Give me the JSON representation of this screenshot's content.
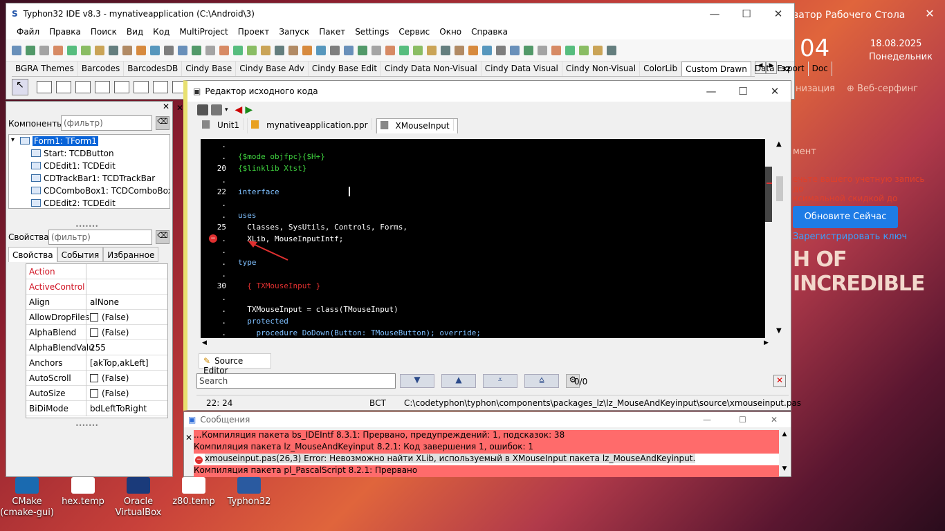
{
  "main": {
    "title": "Typhon32 IDE v8.3 - mynativeapplication (C:\\Android\\3)",
    "menu": [
      "Файл",
      "Правка",
      "Поиск",
      "Вид",
      "Код",
      "MultiProject",
      "Проект",
      "Запуск",
      "Пакет",
      "Settings",
      "Сервис",
      "Окно",
      "Справка"
    ],
    "palette_tabs": [
      "BGRA Themes",
      "Barcodes",
      "BarcodesDB",
      "Cindy Base",
      "Cindy Base Adv",
      "Cindy Base Edit",
      "Cindy Data Non-Visual",
      "Cindy Data Visual",
      "Cindy Non-Visual",
      "ColorLib",
      "Custom Drawn",
      "Data Export",
      "Doc"
    ],
    "bitness": "32"
  },
  "inspector": {
    "components_label": "Компоненты",
    "filter_placeholder": "(фильтр)",
    "tree": [
      "Form1: TForm1",
      "Start: TCDButton",
      "CDEdit1: TCDEdit",
      "CDTrackBar1: TCDTrackBar",
      "CDComboBox1: TCDComboBox",
      "CDEdit2: TCDEdit"
    ],
    "props_label": "Свойства",
    "props_filter_placeholder": "(фильтр)",
    "tabs": [
      "Свойства",
      "События",
      "Избранное"
    ],
    "rows": [
      {
        "name": "Action",
        "value": ""
      },
      {
        "name": "ActiveControl",
        "value": ""
      },
      {
        "name": "Align",
        "value": "alNone"
      },
      {
        "name": "AllowDropFiles",
        "value": "(False)"
      },
      {
        "name": "AlphaBlend",
        "value": "(False)"
      },
      {
        "name": "AlphaBlendValu",
        "value": "255"
      },
      {
        "name": "Anchors",
        "value": "[akTop,akLeft]"
      },
      {
        "name": "AutoScroll",
        "value": "(False)"
      },
      {
        "name": "AutoSize",
        "value": "(False)"
      },
      {
        "name": "BiDiMode",
        "value": "bdLeftToRight"
      }
    ]
  },
  "editor": {
    "title": "Редактор исходного кода",
    "tabs": [
      "Unit1",
      "mynativeapplication.ppr",
      "XMouseInput"
    ],
    "lines": [
      {
        "n": ".",
        "t": ""
      },
      {
        "n": ".",
        "t": "{$mode objfpc}{$H+}"
      },
      {
        "n": "20",
        "t": "{$linklib Xtst}"
      },
      {
        "n": ".",
        "t": ""
      },
      {
        "n": "22",
        "t": "interface"
      },
      {
        "n": ".",
        "t": ""
      },
      {
        "n": ".",
        "t": "uses"
      },
      {
        "n": "25",
        "t": "  Classes, SysUtils, Controls, Forms,"
      },
      {
        "n": ".",
        "t": "  XLib, MouseInputIntf;"
      },
      {
        "n": ".",
        "t": ""
      },
      {
        "n": ".",
        "t": "type"
      },
      {
        "n": ".",
        "t": ""
      },
      {
        "n": "30",
        "t": "  { TXMouseInput }"
      },
      {
        "n": ".",
        "t": ""
      },
      {
        "n": ".",
        "t": "  TXMouseInput = class(TMouseInput)"
      },
      {
        "n": ".",
        "t": "  protected"
      },
      {
        "n": ".",
        "t": "    procedure DoDown(Button: TMouseButton); override;"
      }
    ],
    "bottom_tab": "Source Editor",
    "search_placeholder": "Search",
    "search_count": "0/0",
    "status": {
      "pos": "22: 24",
      "mode": "ВСТ",
      "path": "C:\\codetyphon\\typhon\\components\\packages_lz\\lz_MouseAndKeyinput\\source\\xmouseinput.pas"
    }
  },
  "messages": {
    "title": "Сообщения",
    "items": [
      "...Компиляция пакета bs_IDEIntf 8.3.1: Прервано, предупреждений: 1, подсказок: 38",
      "Компиляция пакета lz_MouseAndKeyinput 8.2.1: Код завершения 1, ошибок: 1",
      "xmouseinput.pas(26,3) Error: Невозможно найти XLib, используемый в XMouseInput пакета lz_MouseAndKeyinput.",
      "Компиляция пакета pl_PascalScript 8.2.1: Прервано"
    ]
  },
  "background": {
    "title": "ватор Рабочего Стола",
    "time": "04",
    "date": "18.08.2025",
    "day": "Понедельник",
    "link1": "низация",
    "link2": "Веб-серфинг",
    "menu": "мент",
    "promo": "ечьте вашего учетную запись до\nксимальной скидкой до",
    "button": "Обновите Сейчас",
    "register": "Зарегистрировать ключ",
    "banner": "H OF INCREDIBLE"
  },
  "desktop": [
    {
      "label": "CMake\n(cmake-gui)"
    },
    {
      "label": "hex.temp"
    },
    {
      "label": "Oracle\nVirtualBox"
    },
    {
      "label": "z80.temp"
    },
    {
      "label": "Typhon32"
    }
  ],
  "colors": {
    "error_bg": "#ff6b6b",
    "selection": "#0a64d8",
    "keyword": "#7fc0ff",
    "directive": "#3fd23f",
    "comment": "#e03030"
  }
}
